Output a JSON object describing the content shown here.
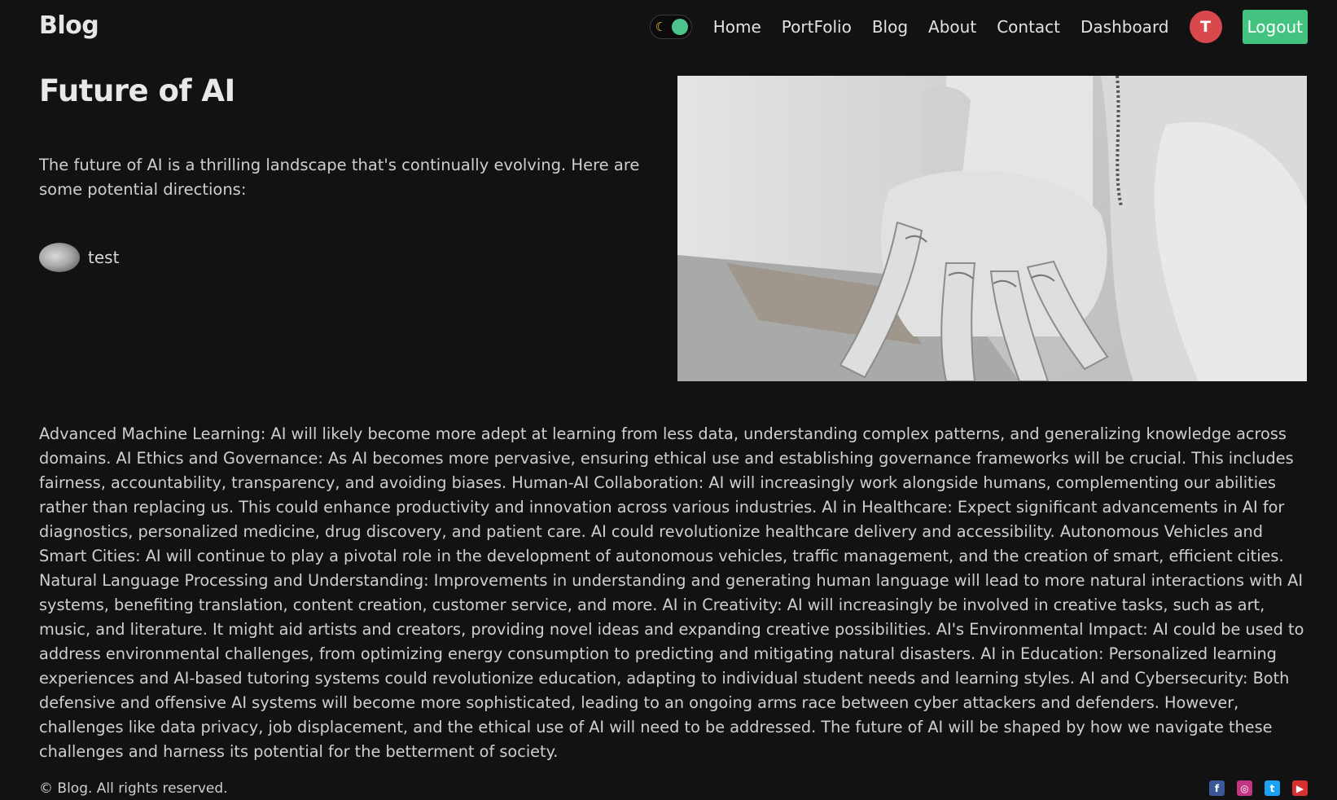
{
  "header": {
    "brand": "Blog",
    "nav": [
      "Home",
      "PortFolio",
      "Blog",
      "About",
      "Contact",
      "Dashboard"
    ],
    "avatar_initial": "T",
    "logout_label": "Logout",
    "theme_toggle_icon": "moon-icon"
  },
  "post": {
    "title": "Future of AI",
    "intro": "The future of AI is a thrilling landscape that's continually evolving. Here are some potential directions:",
    "author": "test",
    "body": "Advanced Machine Learning: AI will likely become more adept at learning from less data, understanding complex patterns, and generalizing knowledge across domains. AI Ethics and Governance: As AI becomes more pervasive, ensuring ethical use and establishing governance frameworks will be crucial. This includes fairness, accountability, transparency, and avoiding biases. Human-AI Collaboration: AI will increasingly work alongside humans, complementing our abilities rather than replacing us. This could enhance productivity and innovation across various industries. AI in Healthcare: Expect significant advancements in AI for diagnostics, personalized medicine, drug discovery, and patient care. AI could revolutionize healthcare delivery and accessibility. Autonomous Vehicles and Smart Cities: AI will continue to play a pivotal role in the development of autonomous vehicles, traffic management, and the creation of smart, efficient cities. Natural Language Processing and Understanding: Improvements in understanding and generating human language will lead to more natural interactions with AI systems, benefiting translation, content creation, customer service, and more. AI in Creativity: AI will increasingly be involved in creative tasks, such as art, music, and literature. It might aid artists and creators, providing novel ideas and expanding creative possibilities. AI's Environmental Impact: AI could be used to address environmental challenges, from optimizing energy consumption to predicting and mitigating natural disasters. AI in Education: Personalized learning experiences and AI-based tutoring systems could revolutionize education, adapting to individual student needs and learning styles. AI and Cybersecurity: Both defensive and offensive AI systems will become more sophisticated, leading to an ongoing arms race between cyber attackers and defenders. However, challenges like data privacy, job displacement, and the ethical use of AI will need to be addressed. The future of AI will be shaped by how we navigate these challenges and harness its potential for the betterment of society."
  },
  "footer": {
    "copyright": "© Blog. All rights reserved.",
    "socials": [
      {
        "name": "facebook-icon",
        "glyph": "f",
        "color": "#3b5998"
      },
      {
        "name": "instagram-icon",
        "glyph": "◎",
        "color": "#c13584"
      },
      {
        "name": "twitter-icon",
        "glyph": "t",
        "color": "#1da1f2"
      },
      {
        "name": "youtube-icon",
        "glyph": "▶",
        "color": "#d63031"
      }
    ]
  },
  "colors": {
    "background": "#121212",
    "accent_green": "#42c480",
    "avatar_red": "#d9484d"
  }
}
